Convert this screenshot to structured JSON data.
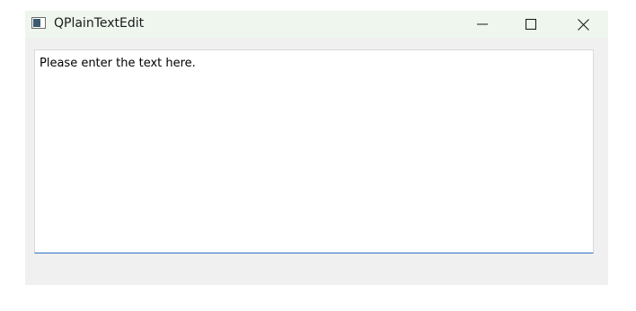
{
  "window": {
    "title": "QPlainTextEdit",
    "icon": "qt-window-icon",
    "controls": {
      "minimize_icon": "minimize-icon",
      "maximize_icon": "maximize-icon",
      "close_icon": "close-icon"
    }
  },
  "editor": {
    "text": "Please enter the text here."
  },
  "colors": {
    "titlebar": "#eef6ee",
    "window_bg": "#f0f0f0",
    "editor_bg": "#ffffff",
    "focus_accent": "#2e6fc5"
  }
}
